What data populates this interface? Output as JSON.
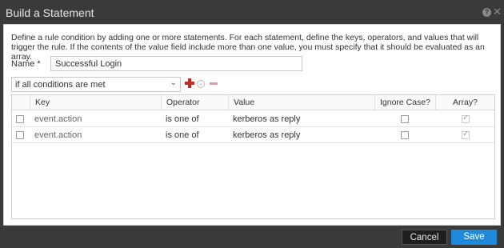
{
  "dialog": {
    "title": "Build a Statement",
    "description": "Define a rule condition by adding one or more statements. For each statement, define the keys, operators, and values that will trigger the rule. If the contents of the value field include more than one value, you must specify that it should be evaluated as an array."
  },
  "name_field": {
    "label": "Name *",
    "value": "Successful Login"
  },
  "condition": {
    "selected": "if all conditions are met"
  },
  "table": {
    "headers": {
      "key": "Key",
      "operator": "Operator",
      "value": "Value",
      "ignore_case": "Ignore Case?",
      "array": "Array?"
    },
    "rows": [
      {
        "key": "event.action",
        "operator": "is one of",
        "value": "kerberos as reply",
        "ignore_case": false,
        "array": true
      },
      {
        "key": "event.action",
        "operator": "is one of",
        "value": "kerberos as reply",
        "ignore_case": false,
        "array": true
      }
    ]
  },
  "buttons": {
    "cancel": "Cancel",
    "save": "Save"
  },
  "colors": {
    "titlebar": "#3a3a3a",
    "save_button": "#1f8ad9",
    "add_icon": "#cc2a2a",
    "remove_icon": "#e29a9a"
  },
  "icons": {
    "help": "help-icon",
    "close": "close-icon",
    "add": "plus-icon",
    "more": "chevron-circle-icon",
    "remove": "minus-icon"
  }
}
